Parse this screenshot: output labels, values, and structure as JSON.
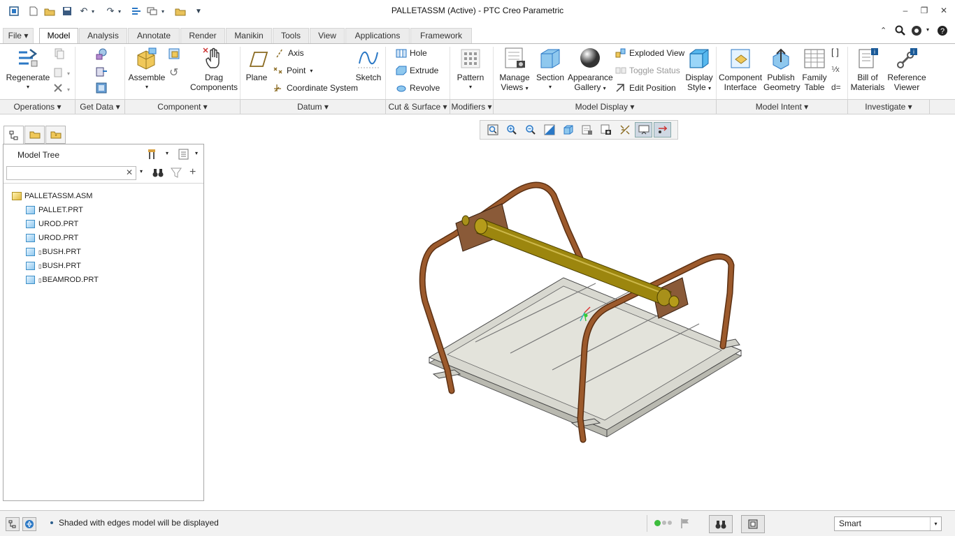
{
  "window": {
    "title": "PALLETASSM (Active) - PTC Creo Parametric"
  },
  "tabs": [
    {
      "label": "File"
    },
    {
      "label": "Model"
    },
    {
      "label": "Analysis"
    },
    {
      "label": "Annotate"
    },
    {
      "label": "Render"
    },
    {
      "label": "Manikin"
    },
    {
      "label": "Tools"
    },
    {
      "label": "View"
    },
    {
      "label": "Applications"
    },
    {
      "label": "Framework"
    }
  ],
  "ribbon": {
    "regenerate": "Regenerate",
    "assemble": "Assemble",
    "drag_l1": "Drag",
    "drag_l2": "Components",
    "plane": "Plane",
    "axis": "Axis",
    "point": "Point",
    "coord": "Coordinate System",
    "sketch": "Sketch",
    "hole": "Hole",
    "extrude": "Extrude",
    "revolve": "Revolve",
    "pattern": "Pattern",
    "manage_l1": "Manage",
    "manage_l2": "Views",
    "section": "Section",
    "appearance_l1": "Appearance",
    "appearance_l2": "Gallery",
    "exploded": "Exploded View",
    "toggle": "Toggle Status",
    "editpos": "Edit Position",
    "display_l1": "Display",
    "display_l2": "Style",
    "compint_l1": "Component",
    "compint_l2": "Interface",
    "publish_l1": "Publish",
    "publish_l2": "Geometry",
    "family_l1": "Family",
    "family_l2": "Table",
    "bom_l1": "Bill of",
    "bom_l2": "Materials",
    "ref_l1": "Reference",
    "ref_l2": "Viewer"
  },
  "groups": [
    "Operations",
    "Get Data",
    "Component",
    "Datum",
    "Cut & Surface",
    "Modifiers",
    "Model Display",
    "Model Intent",
    "Investigate"
  ],
  "tree": {
    "title": "Model Tree",
    "search_value": "",
    "items": [
      {
        "label": "PALLETASSM.ASM"
      },
      {
        "label": "PALLET.PRT"
      },
      {
        "label": "UROD.PRT"
      },
      {
        "label": "UROD.PRT"
      },
      {
        "label": "BUSH.PRT"
      },
      {
        "label": "BUSH.PRT"
      },
      {
        "label": "BEAMROD.PRT"
      }
    ]
  },
  "status": {
    "message": "Shaded with edges model will be displayed",
    "filter_value": "Smart"
  },
  "colors": {
    "rod": "#8a4b22",
    "shaft": "#a08a10",
    "pallet": "#d8d8d0",
    "accent": "#2b78c5"
  }
}
